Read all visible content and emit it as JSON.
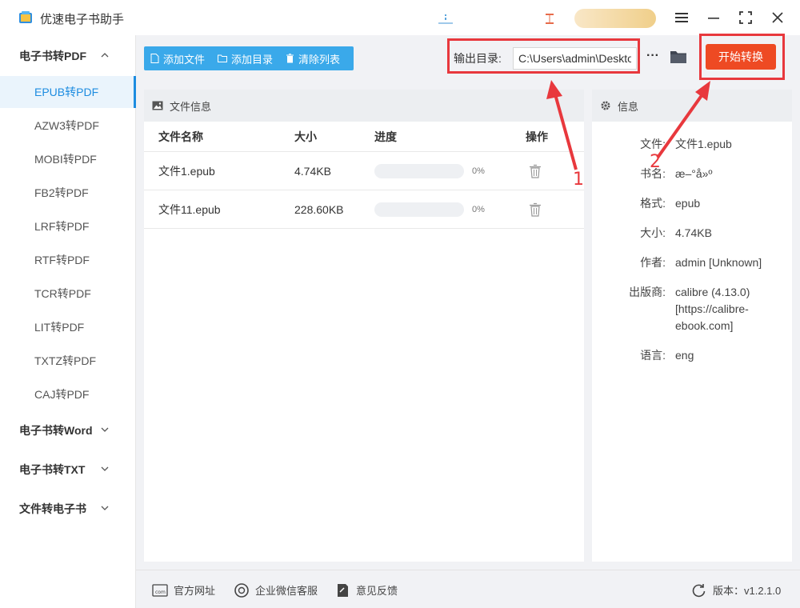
{
  "app": {
    "title": "优速电子书助手"
  },
  "sidebar": {
    "groups": [
      {
        "label": "电子书转PDF",
        "expanded": true
      },
      {
        "label": "电子书转Word",
        "expanded": false
      },
      {
        "label": "电子书转TXT",
        "expanded": false
      },
      {
        "label": "文件转电子书",
        "expanded": false
      }
    ],
    "items": [
      {
        "label": "EPUB转PDF",
        "active": true
      },
      {
        "label": "AZW3转PDF"
      },
      {
        "label": "MOBI转PDF"
      },
      {
        "label": "FB2转PDF"
      },
      {
        "label": "LRF转PDF"
      },
      {
        "label": "RTF转PDF"
      },
      {
        "label": "TCR转PDF"
      },
      {
        "label": "LIT转PDF"
      },
      {
        "label": "TXTZ转PDF"
      },
      {
        "label": "CAJ转PDF"
      }
    ]
  },
  "toolbar": {
    "add_file": "添加文件",
    "add_dir": "添加目录",
    "clear_list": "清除列表",
    "output_label": "输出目录:",
    "output_value": "C:\\Users\\admin\\Desktop",
    "more": "···",
    "start": "开始转换"
  },
  "file_panel": {
    "title": "文件信息",
    "columns": {
      "name": "文件名称",
      "size": "大小",
      "progress": "进度",
      "op": "操作"
    },
    "rows": [
      {
        "name": "文件1.epub",
        "size": "4.74KB",
        "progress": "0%",
        "progress_value": 0
      },
      {
        "name": "文件11.epub",
        "size": "228.60KB",
        "progress": "0%",
        "progress_value": 0
      }
    ]
  },
  "info_panel": {
    "title": "信息",
    "fields": [
      {
        "key": "文件:",
        "value": "文件1.epub"
      },
      {
        "key": "书名:",
        "value": "æ–°å»º"
      },
      {
        "key": "格式:",
        "value": "epub"
      },
      {
        "key": "大小:",
        "value": "4.74KB"
      },
      {
        "key": "作者:",
        "value": "admin [Unknown]"
      },
      {
        "key": "出版商:",
        "value": "calibre (4.13.0) [https://calibre-ebook.com]"
      },
      {
        "key": "语言:",
        "value": "eng"
      }
    ]
  },
  "footer": {
    "website": "官方网址",
    "wechat": "企业微信客服",
    "feedback": "意见反馈",
    "version": "版本：v1.2.1.0"
  },
  "annotations": {
    "one": "1",
    "two": "2"
  },
  "colors": {
    "accent": "#3aa9ea",
    "start": "#ee4a23",
    "highlight": "#e8383d",
    "active": "#1d8ce0"
  }
}
